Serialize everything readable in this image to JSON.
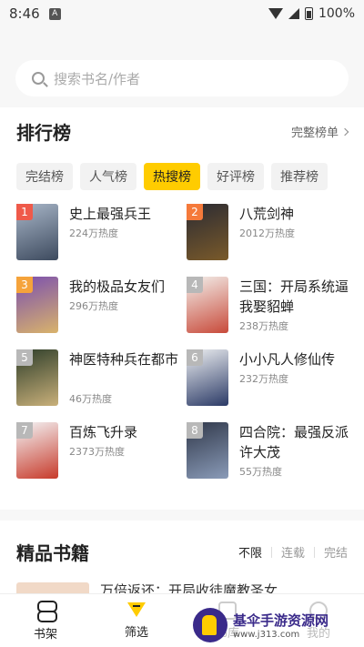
{
  "status_bar": {
    "time": "8:46",
    "a_badge": "A",
    "battery": "100%"
  },
  "search": {
    "placeholder": "搜索书名/作者"
  },
  "ranking": {
    "title": "排行榜",
    "more_link": "完整榜单",
    "tabs": [
      {
        "label": "完结榜",
        "active": false
      },
      {
        "label": "人气榜",
        "active": false
      },
      {
        "label": "热搜榜",
        "active": true
      },
      {
        "label": "好评榜",
        "active": false
      },
      {
        "label": "推荐榜",
        "active": false
      }
    ],
    "books": [
      {
        "rank": "1",
        "title": "史上最强兵王",
        "heat": "224万热度",
        "cover_colors": [
          "#a8b6c8",
          "#3d4a5e"
        ]
      },
      {
        "rank": "2",
        "title": "八荒剑神",
        "heat": "2012万热度",
        "cover_colors": [
          "#2b2b33",
          "#7a5a2a"
        ]
      },
      {
        "rank": "3",
        "title": "我的极品女友们",
        "heat": "296万热度",
        "cover_colors": [
          "#7a4fb0",
          "#d9b36b"
        ]
      },
      {
        "rank": "4",
        "title": "三国：开局系统逼我娶貂蝉",
        "heat": "238万热度",
        "cover_colors": [
          "#f3f0ec",
          "#c84a3a"
        ]
      },
      {
        "rank": "5",
        "title": "神医特种兵在都市",
        "heat": "46万热度",
        "cover_colors": [
          "#2e3e2a",
          "#c9b07a"
        ]
      },
      {
        "rank": "6",
        "title": "小小凡人修仙传",
        "heat": "232万热度",
        "cover_colors": [
          "#eef0f2",
          "#2b3a66"
        ]
      },
      {
        "rank": "7",
        "title": "百炼飞升录",
        "heat": "2373万热度",
        "cover_colors": [
          "#f4f6f8",
          "#c73a2a"
        ]
      },
      {
        "rank": "8",
        "title": "四合院：最强反派许大茂",
        "heat": "55万热度",
        "cover_colors": [
          "#30384a",
          "#8a9bb8"
        ]
      }
    ]
  },
  "premium": {
    "title": "精品书籍",
    "filters": [
      "不限",
      "连载",
      "完结"
    ],
    "peek_title": "万倍返还：开局收徒魔教圣女"
  },
  "bottom_nav": {
    "items": [
      {
        "label": "书架",
        "icon": "bookshelf-icon"
      },
      {
        "label": "筛选",
        "icon": "filter-icon"
      },
      {
        "label": "书库",
        "icon": "store-icon"
      },
      {
        "label": "我的",
        "icon": "profile-icon"
      }
    ]
  },
  "watermark": {
    "title": "基伞手游资源网",
    "url": "www.j313.com"
  },
  "colors": {
    "accent": "#ffcc00",
    "rank1": "#ef5a4a",
    "rank2": "#f57a3b",
    "rank3": "#f5a33b"
  }
}
